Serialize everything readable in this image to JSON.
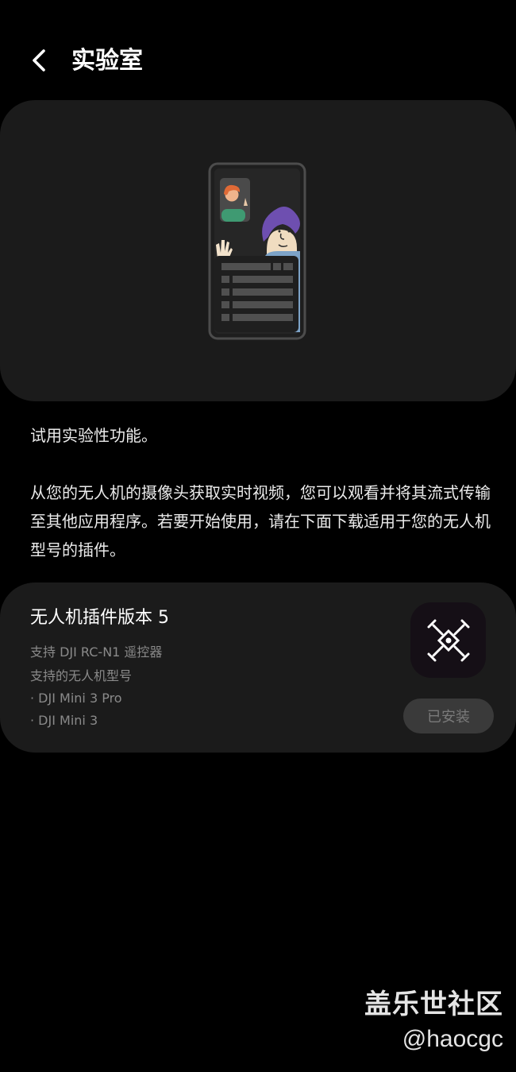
{
  "header": {
    "title": "实验室",
    "back_icon": "chevron-left-icon"
  },
  "hero": {
    "illustration": "video-call-phone-illustration"
  },
  "intro": {
    "line1": "试用实验性功能。",
    "line2": "从您的无人机的摄像头获取实时视频，您可以观看并将其流式传输至其他应用程序。若要开始使用，请在下面下载适用于您的无人机型号的插件。"
  },
  "plugin": {
    "title": "无人机插件版本 5",
    "controller": "支持 DJI RC-N1 遥控器",
    "models_heading": "支持的无人机型号",
    "models": [
      "· DJI Mini 3 Pro",
      "· DJI Mini 3"
    ],
    "icon": "drone-icon",
    "status_label": "已安装"
  },
  "watermark": {
    "name": "盖乐世社区",
    "handle": "@haocgc"
  },
  "colors": {
    "background": "#000000",
    "card": "#1b1b1b",
    "icon_tile": "#150f16",
    "button_disabled": "#3a3a3a",
    "secondary_text": "#8a8a8a"
  }
}
